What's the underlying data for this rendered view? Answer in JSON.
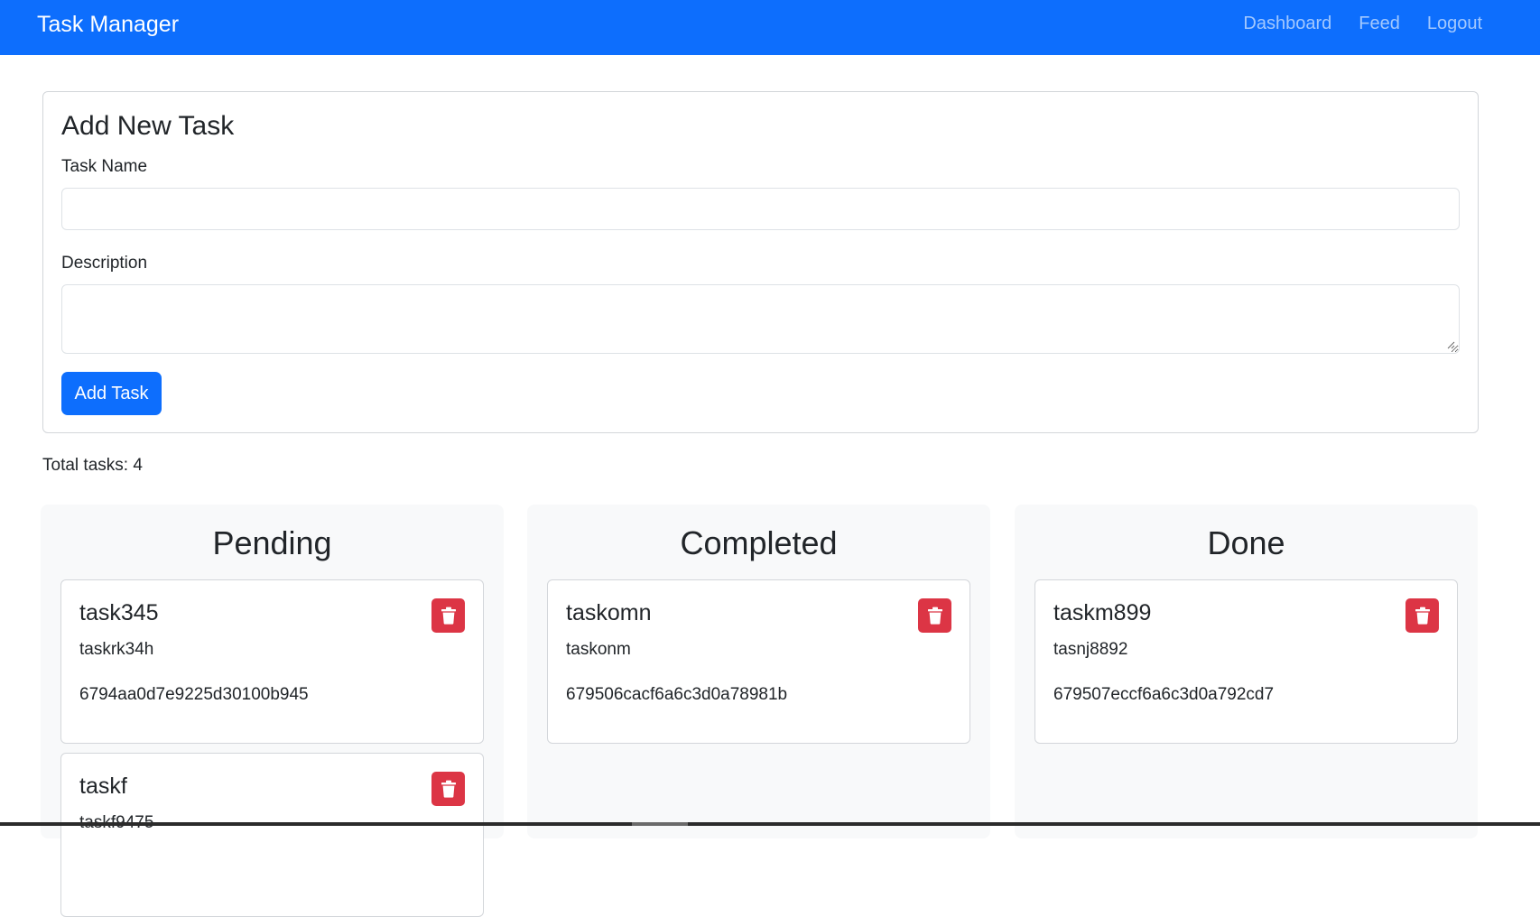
{
  "navbar": {
    "brand": "Task Manager",
    "links": [
      "Dashboard",
      "Feed",
      "Logout"
    ],
    "background": "#0d6efd"
  },
  "form": {
    "title": "Add New Task",
    "task_name_label": "Task Name",
    "task_name_value": "",
    "description_label": "Description",
    "description_value": "",
    "submit_label": "Add Task"
  },
  "total_tasks": "Total tasks: 4",
  "columns": [
    {
      "title": "Pending",
      "tasks": [
        {
          "name": "task345",
          "description": "taskrk34h",
          "id": "6794aa0d7e9225d30100b945"
        },
        {
          "name": "taskf",
          "description": "taskf9475",
          "id": ""
        }
      ]
    },
    {
      "title": "Completed",
      "tasks": [
        {
          "name": "taskomn",
          "description": "taskonm",
          "id": "679506cacf6a6c3d0a78981b"
        }
      ]
    },
    {
      "title": "Done",
      "tasks": [
        {
          "name": "taskm899",
          "description": "tasnj8892",
          "id": "679507eccf6a6c3d0a792cd7"
        }
      ]
    }
  ],
  "icons": {
    "delete": "trash-icon"
  },
  "colors": {
    "primary": "#0d6efd",
    "danger": "#dc3545",
    "column_bg": "#f8f9fa"
  }
}
